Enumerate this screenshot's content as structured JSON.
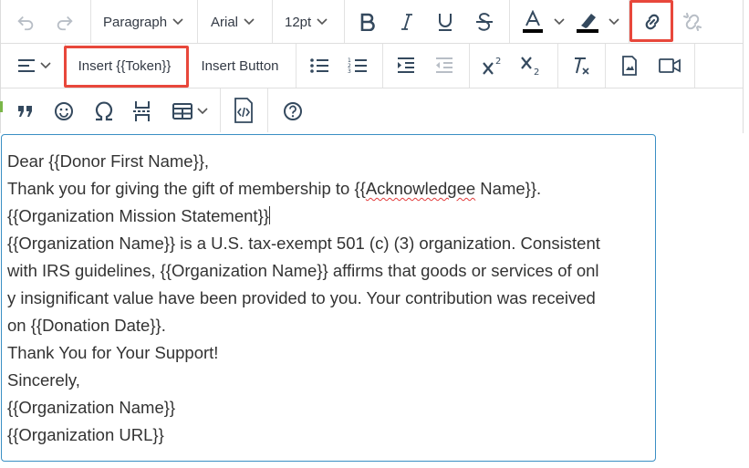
{
  "toolbar": {
    "format_block": "Paragraph",
    "font_family": "Arial",
    "font_size": "12pt",
    "insert_token_label": "Insert {{Token}}",
    "insert_button_label": "Insert Button",
    "highlight_color": "#e8473b",
    "font_color_bar": "#000000"
  },
  "editor": {
    "border_color": "#3a8fc4",
    "lines": {
      "l1": "Dear {{Donor First Name}},",
      "l2_pre": "Thank you for giving the gift of membership to {{",
      "l2_word": "Acknowledgee",
      "l2_post": " Name}}.",
      "l3": "{{Organization Mission Statement}}",
      "l4": "{{Organization Name}} is a U.S. tax-exempt 501 (c) (3) organization. Consistent",
      "l5": "with IRS guidelines, {{Organization Name}} affirms that goods or services of onl",
      "l6": "y insignificant value have been provided to you. Your contribution was received",
      "l7": "on {{Donation Date}}.",
      "l8": "Thank You for Your Support!",
      "l9": "Sincerely,",
      "l10": "{{Organization Name}}",
      "l11": "{{Organization URL}}"
    }
  }
}
